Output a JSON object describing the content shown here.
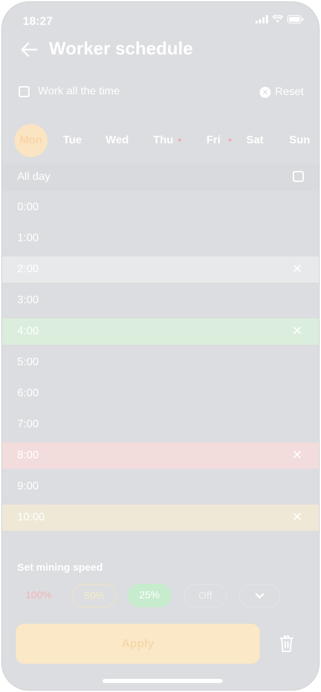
{
  "status_bar": {
    "time": "18:27"
  },
  "header": {
    "title": "Worker schedule"
  },
  "options": {
    "work_all_label": "Work all the time",
    "reset_label": "Reset"
  },
  "days": [
    {
      "label": "Mon",
      "active": true,
      "dot": false
    },
    {
      "label": "Tue",
      "active": false,
      "dot": false
    },
    {
      "label": "Wed",
      "active": false,
      "dot": false
    },
    {
      "label": "Thu",
      "active": false,
      "dot": true
    },
    {
      "label": "Fri",
      "active": false,
      "dot": true
    },
    {
      "label": "Sat",
      "active": false,
      "dot": false
    },
    {
      "label": "Sun",
      "active": false,
      "dot": false
    }
  ],
  "allday": {
    "label": "All day"
  },
  "hours": [
    {
      "label": "0:00",
      "state": "none"
    },
    {
      "label": "1:00",
      "state": "none"
    },
    {
      "label": "2:00",
      "state": "grey"
    },
    {
      "label": "3:00",
      "state": "none"
    },
    {
      "label": "4:00",
      "state": "green"
    },
    {
      "label": "5:00",
      "state": "none"
    },
    {
      "label": "6:00",
      "state": "none"
    },
    {
      "label": "7:00",
      "state": "none"
    },
    {
      "label": "8:00",
      "state": "red"
    },
    {
      "label": "9:00",
      "state": "none"
    },
    {
      "label": "10:00",
      "state": "yellow"
    }
  ],
  "mining": {
    "label": "Set mining speed",
    "options": [
      "100%",
      "50%",
      "25%",
      "Off"
    ],
    "selected": "25%"
  },
  "apply_label": "Apply",
  "colors": {
    "overlay": "#dcdde0",
    "accent": "#fbe4c2",
    "green": "#dbeedd",
    "red": "#f3dcdc",
    "grey": "#e8e9ea",
    "yellow": "#efe8d6"
  }
}
